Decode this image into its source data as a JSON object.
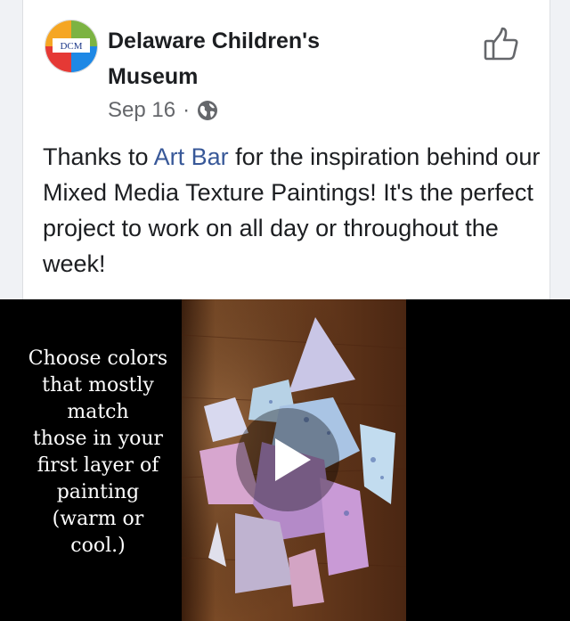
{
  "post": {
    "page_name": "Delaware Children's Museum",
    "date": "Sep 16",
    "separator": "·",
    "privacy_icon": "globe-icon",
    "like_icon": "thumbs-up-icon",
    "avatar_text": "DCM",
    "text_before_link": "Thanks to ",
    "link_text": "Art Bar",
    "text_after_link": " for the inspiration behind our Mixed Media Texture Paintings! It's the perfect project to work on all day or throughout the week!"
  },
  "video": {
    "caption": "Choose colors\nthat mostly\nmatch\nthose in your\nfirst layer of\npainting\n(warm or\ncool.)",
    "play_icon": "play-icon"
  },
  "colors": {
    "link": "#385898",
    "text": "#1c1e21",
    "meta": "#65676b",
    "video_bg": "#000000"
  }
}
